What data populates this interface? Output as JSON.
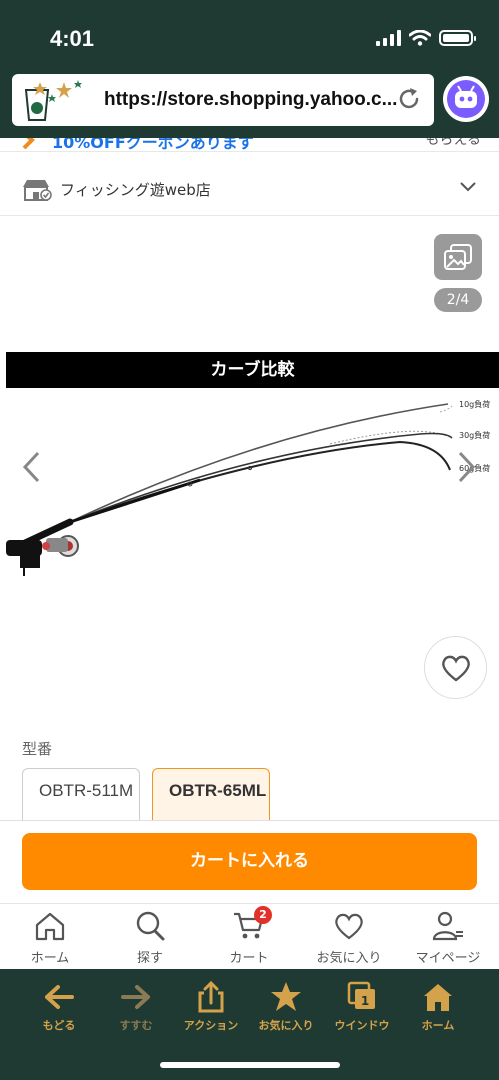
{
  "status": {
    "time": "4:01"
  },
  "browser": {
    "url": "https://store.shopping.yahoo.c..."
  },
  "colors": {
    "header_bg": "#1f3a32",
    "accent": "#ff8a00",
    "toolbar_label": "#d4a24a",
    "link": "#1a73e8",
    "badge": "#e0322a"
  },
  "coupon": {
    "text": "10%OFFクーポンあります",
    "action": "もらえる"
  },
  "store": {
    "name": "フィッシング遊web店"
  },
  "gallery": {
    "counter": "2/4"
  },
  "product_image": {
    "banner": "カーブ比較",
    "load_labels": [
      "10g負荷",
      "30g負荷",
      "60g負荷"
    ]
  },
  "model": {
    "label": "型番",
    "options": [
      {
        "text": "OBTR-511M",
        "selected": false
      },
      {
        "text": "OBTR-65ML",
        "selected": true
      }
    ]
  },
  "cart_button": "カートに入れる",
  "bottom_nav": {
    "items": [
      {
        "label": "ホーム",
        "icon": "home-icon"
      },
      {
        "label": "探す",
        "icon": "search-icon"
      },
      {
        "label": "カート",
        "icon": "cart-icon",
        "badge": "2"
      },
      {
        "label": "お気に入り",
        "icon": "heart-icon"
      },
      {
        "label": "マイページ",
        "icon": "user-icon"
      }
    ]
  },
  "toolbar": {
    "items": [
      {
        "label": "もどる",
        "icon": "back-arrow-icon"
      },
      {
        "label": "すすむ",
        "icon": "forward-arrow-icon",
        "disabled": true
      },
      {
        "label": "アクション",
        "icon": "share-icon"
      },
      {
        "label": "お気に入り",
        "icon": "star-icon"
      },
      {
        "label": "ウインドウ",
        "icon": "window-icon"
      },
      {
        "label": "ホーム",
        "icon": "home-icon"
      }
    ]
  }
}
